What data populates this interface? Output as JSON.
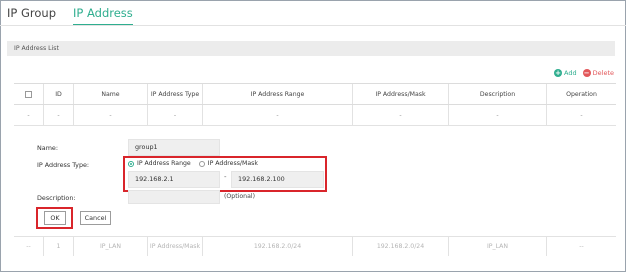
{
  "tabs": [
    {
      "label": "IP Group",
      "active": false
    },
    {
      "label": "IP Address",
      "active": true
    }
  ],
  "section_title": "IP Address List",
  "toolbar": {
    "add_label": "Add",
    "delete_label": "Delete",
    "add_symbol": "+",
    "delete_symbol": "−"
  },
  "table": {
    "headers": [
      "",
      "ID",
      "Name",
      "IP Address Type",
      "IP Address Range",
      "IP Address/Mask",
      "Description",
      "Operation"
    ],
    "placeholder_row": [
      "-",
      "-",
      "-",
      "-",
      "-",
      "-",
      "-",
      "-"
    ],
    "data_row": [
      "--",
      "1",
      "IP_LAN",
      "IP Address/Mask",
      "192.168.2.0/24",
      "192.168.2.0/24",
      "IP_LAN",
      "--"
    ]
  },
  "form": {
    "name_label": "Name:",
    "name_value": "group1",
    "type_label": "IP Address Type:",
    "radio_range_label": "IP Address Range",
    "radio_mask_label": "IP Address/Mask",
    "range_start": "192.168.2.1",
    "range_separator": "-",
    "range_end": "192.168.2.100",
    "description_label": "Description:",
    "description_value": "",
    "optional_hint": "(Optional)",
    "ok_label": "OK",
    "cancel_label": "Cancel"
  },
  "colors": {
    "accent": "#2fae8f",
    "highlight": "#d9252b",
    "delete": "#e2575a"
  }
}
